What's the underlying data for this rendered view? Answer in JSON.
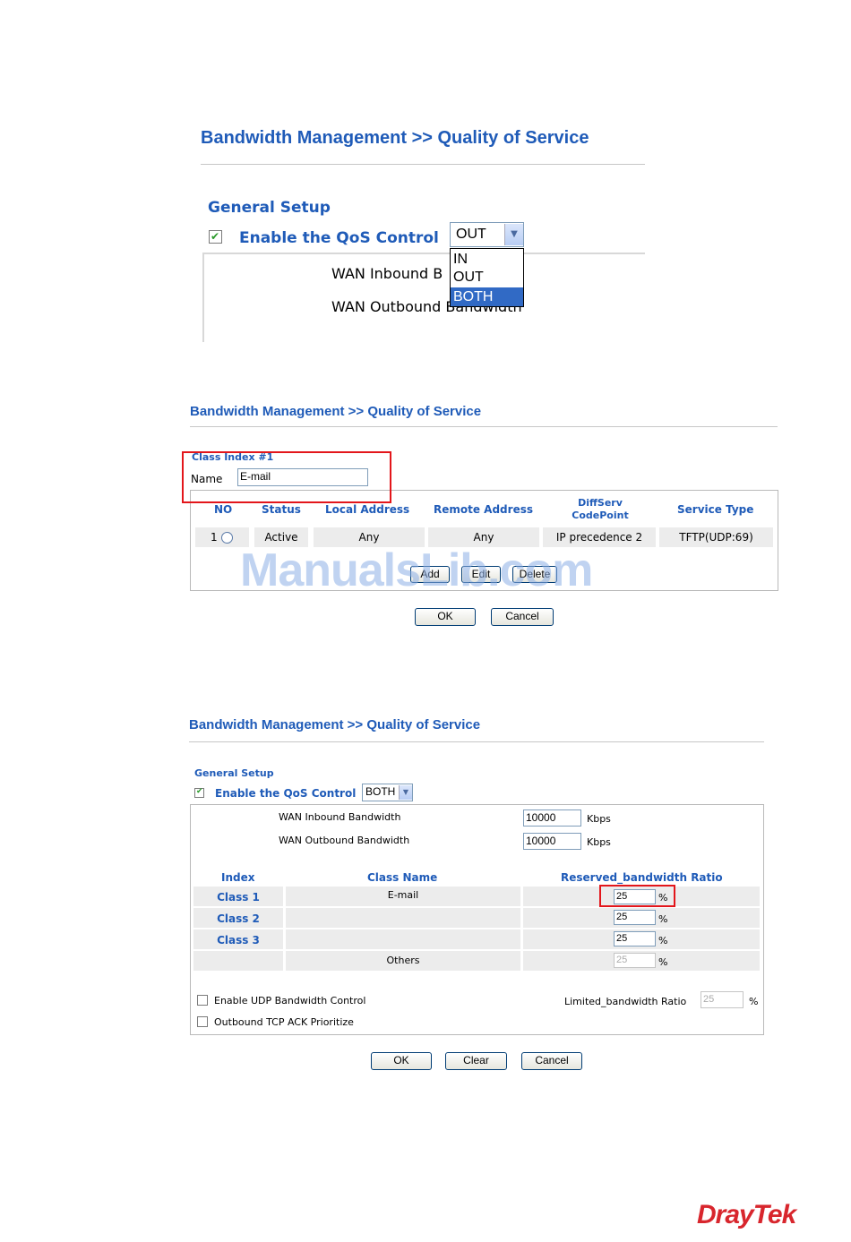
{
  "shot1": {
    "title": "Bandwidth Management >> Quality of Service",
    "general_setup": "General Setup",
    "enable_qos_label": "Enable the QoS Control",
    "direction_selected": "OUT",
    "direction_options": [
      "IN",
      "OUT",
      "BOTH"
    ],
    "highlighted_option": "BOTH",
    "wan_inbound_label": "WAN Inbound B",
    "wan_outbound_label": "WAN Outbound Bandwidth"
  },
  "shot2": {
    "title": "Bandwidth Management >> Quality of Service",
    "class_index": "Class Index #1",
    "name_label": "Name",
    "name_value": "E-mail",
    "columns": [
      "NO",
      "Status",
      "Local Address",
      "Remote Address",
      "DiffServ CodePoint",
      "Service Type"
    ],
    "row": {
      "no": "1",
      "status": "Active",
      "local": "Any",
      "remote": "Any",
      "diffserv": "IP precedence 2",
      "service": "TFTP(UDP:69)"
    },
    "add_label": "Add",
    "edit_label": "Edit",
    "delete_label": "Delete",
    "ok_label": "OK",
    "cancel_label": "Cancel",
    "watermark": "ManualsLib.com"
  },
  "shot3": {
    "title": "Bandwidth Management >> Quality of Service",
    "general_setup": "General Setup",
    "enable_qos_label": "Enable the QoS Control",
    "direction_selected": "BOTH",
    "wan_inbound_label": "WAN Inbound Bandwidth",
    "wan_inbound_value": "10000",
    "wan_outbound_label": "WAN Outbound Bandwidth",
    "wan_outbound_value": "10000",
    "kbps": "Kbps",
    "col_index": "Index",
    "col_class_name": "Class Name",
    "col_ratio": "Reserved_bandwidth Ratio",
    "classes": [
      {
        "index": "Class 1",
        "name": "E-mail",
        "ratio": "25"
      },
      {
        "index": "Class 2",
        "name": "",
        "ratio": "25"
      },
      {
        "index": "Class 3",
        "name": "",
        "ratio": "25"
      },
      {
        "index": "",
        "name": "Others",
        "ratio": "25"
      }
    ],
    "percent": "%",
    "udp_label": "Enable UDP Bandwidth Control",
    "limited_label": "Limited_bandwidth Ratio",
    "limited_value": "25",
    "tcp_ack_label": "Outbound TCP ACK Prioritize",
    "ok_label": "OK",
    "clear_label": "Clear",
    "cancel_label": "Cancel"
  },
  "brand": {
    "logo_text": "DrayTek",
    "color": "#d8262d"
  },
  "colors": {
    "accent": "#1f5bb8",
    "highlight_box": "#e3161b",
    "selection": "#316ac5"
  }
}
